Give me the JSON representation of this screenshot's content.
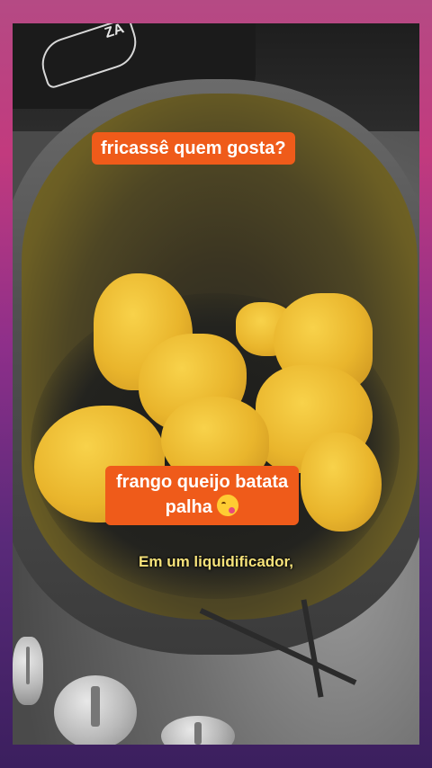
{
  "video": {
    "caption_top": "fricassê quem gosta?",
    "caption_bottom_line1": "frango  queijo batata",
    "caption_bottom_line2": "palha",
    "caption_emoji": "face-savoring-food-emoji",
    "subtitle": "Em um liquidificador,",
    "cloth_print_text": "ZA"
  },
  "colors": {
    "caption_bg": "#ef5b1a",
    "subtitle_text": "#f6e27a",
    "frame_gradient_top": "#b54a84",
    "frame_gradient_bottom": "#3b1f5e"
  }
}
